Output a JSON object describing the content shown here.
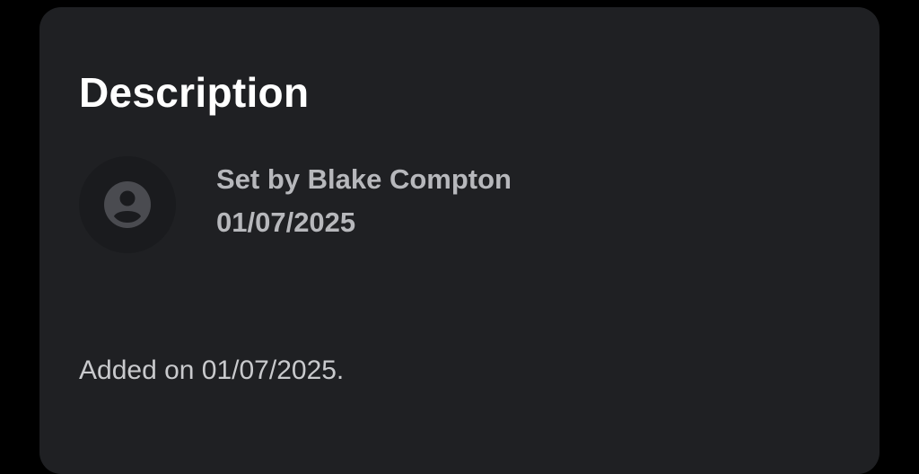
{
  "card": {
    "title": "Description",
    "author": {
      "label": "Set by Blake Compton",
      "date": "01/07/2025",
      "avatar_icon": "person-circle-icon"
    },
    "added_text": "Added on 01/07/2025."
  },
  "colors": {
    "background": "#000000",
    "card": "#1f2023",
    "title": "#ffffff",
    "meta_text": "#b7b8bc",
    "added_text": "#c9cacd",
    "avatar_bg": "#1a1b1e",
    "avatar_icon": "#4a4b50"
  }
}
